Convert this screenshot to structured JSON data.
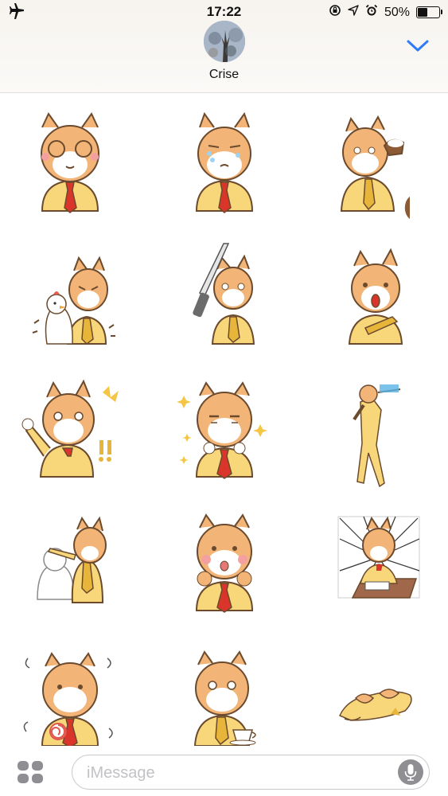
{
  "status_bar": {
    "time": "17:22",
    "battery": "50%",
    "battery_level": 0.5,
    "icons": [
      "airplane-icon",
      "rotation-lock-icon",
      "location-icon",
      "alarm-icon",
      "battery-icon"
    ]
  },
  "header": {
    "contact_name": "Crise"
  },
  "composer": {
    "placeholder": "iMessage"
  },
  "colors": {
    "accent": "#2f7cf6",
    "fur": "#f2b577",
    "suit": "#f7d77a",
    "tie": "#d9352a"
  },
  "stickers": [
    "cat-covering-eyes",
    "cat-crying",
    "cat-drinking-coffee",
    "cat-with-bird",
    "cat-with-knife",
    "cat-surprised",
    "cat-excited",
    "cat-sparkling",
    "cat-flying",
    "cat-patting-ghost",
    "cat-blushing",
    "cat-studying",
    "cat-dizzy",
    "cat-holding-cup",
    "cat-sleeping"
  ]
}
